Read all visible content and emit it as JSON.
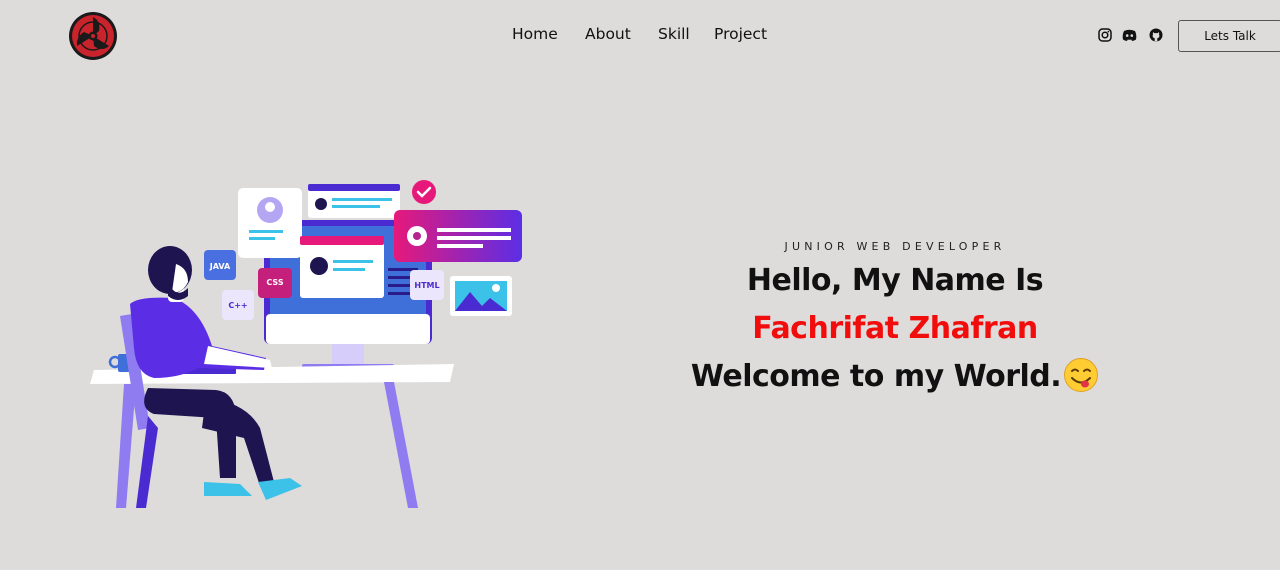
{
  "nav": {
    "links": [
      "Home",
      "About",
      "Skill",
      "Project"
    ],
    "cta": "Lets Talk",
    "social_icons": [
      "instagram-icon",
      "discord-icon",
      "github-icon"
    ]
  },
  "illustration": {
    "tags": [
      "JAVA",
      "CSS",
      "C++",
      "HTML"
    ]
  },
  "hero": {
    "role": "JUNIOR WEB DEVELOPER",
    "line1": "Hello, My Name Is",
    "name": "Fachrifat Zhafran",
    "line3": "Welcome to my World.",
    "name_color": "#f20d0d"
  },
  "colors": {
    "background": "#dedbdb",
    "accent_purple": "#5b2ee6",
    "accent_pink": "#e6197a"
  }
}
